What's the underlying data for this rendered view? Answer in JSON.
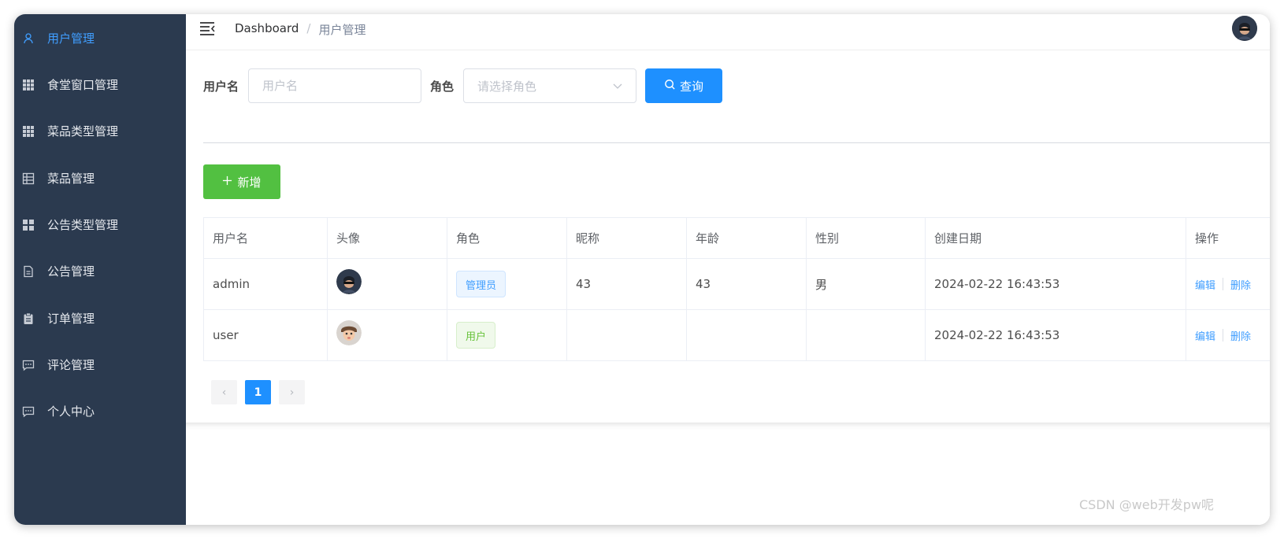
{
  "sidebar": {
    "items": [
      {
        "label": "用户管理",
        "icon": "user-icon",
        "active": true
      },
      {
        "label": "食堂窗口管理",
        "icon": "grid-icon"
      },
      {
        "label": "菜品类型管理",
        "icon": "grid-icon"
      },
      {
        "label": "菜品管理",
        "icon": "table-icon"
      },
      {
        "label": "公告类型管理",
        "icon": "apps-icon"
      },
      {
        "label": "公告管理",
        "icon": "document-icon"
      },
      {
        "label": "订单管理",
        "icon": "clipboard-icon"
      },
      {
        "label": "评论管理",
        "icon": "chat-icon"
      },
      {
        "label": "个人中心",
        "icon": "chat-icon"
      }
    ]
  },
  "header": {
    "breadcrumb": {
      "root": "Dashboard",
      "separator": "/",
      "current": "用户管理"
    }
  },
  "search": {
    "username_label": "用户名",
    "username_placeholder": "用户名",
    "role_label": "角色",
    "role_placeholder": "请选择角色",
    "query_button": "查询"
  },
  "toolbar": {
    "add_button": "新增"
  },
  "table": {
    "columns": [
      "用户名",
      "头像",
      "角色",
      "昵称",
      "年龄",
      "性别",
      "创建日期",
      "操作"
    ],
    "rows": [
      {
        "username": "admin",
        "avatar": "admin-avatar",
        "role": "管理员",
        "nickname": "43",
        "age": "43",
        "gender": "男",
        "created": "2024-02-22 16:43:53",
        "edit": "编辑",
        "delete": "删除"
      },
      {
        "username": "user",
        "avatar": "user-avatar",
        "role": "用户",
        "nickname": "",
        "age": "",
        "gender": "",
        "created": "2024-02-22 16:43:53",
        "edit": "编辑",
        "delete": "删除"
      }
    ]
  },
  "pagination": {
    "current_page": "1",
    "prev": "‹",
    "next": "›"
  },
  "watermark": "CSDN @web开发pw呢",
  "colors": {
    "sidebar_bg": "#2b3a4f",
    "primary": "#1e90ff",
    "success": "#52c041",
    "active_menu": "#409eff"
  }
}
